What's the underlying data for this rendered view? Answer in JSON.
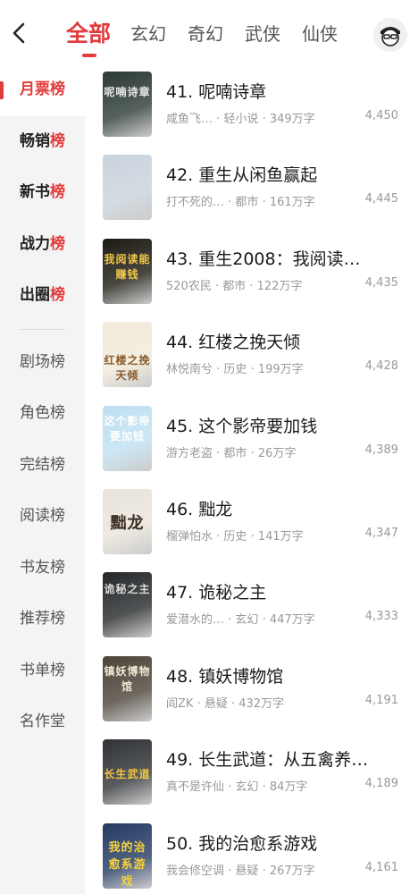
{
  "tabs": [
    "全部",
    "玄幻",
    "奇幻",
    "武侠",
    "仙侠"
  ],
  "sidebar": [
    {
      "main": "月票",
      "tail": "榜"
    },
    {
      "main": "畅销",
      "tail": "榜"
    },
    {
      "main": "新书",
      "tail": "榜"
    },
    {
      "main": "战力",
      "tail": "榜"
    },
    {
      "main": "出圈",
      "tail": "榜"
    },
    {
      "main": "剧场榜",
      "tail": ""
    },
    {
      "main": "角色榜",
      "tail": ""
    },
    {
      "main": "完结榜",
      "tail": ""
    },
    {
      "main": "阅读榜",
      "tail": ""
    },
    {
      "main": "书友榜",
      "tail": ""
    },
    {
      "main": "推荐榜",
      "tail": ""
    },
    {
      "main": "书单榜",
      "tail": ""
    },
    {
      "main": "名作堂",
      "tail": ""
    }
  ],
  "books": [
    {
      "title": "41. 呢喃诗章",
      "author": "咸鱼飞…",
      "genre": "轻小说",
      "words": "349万字",
      "votes": "4,450",
      "cover_text": "呢喃诗章",
      "cover_color": "#2c3a33",
      "cover_text_color": "#e8e8e8"
    },
    {
      "title": "42. 重生从闲鱼赢起",
      "author": "打不死的…",
      "genre": "都市",
      "words": "161万字",
      "votes": "4,445",
      "cover_text": "",
      "cover_color": "#c9d3dc",
      "cover_text_color": "#333333"
    },
    {
      "title": "43. 重生2008：我阅读…",
      "author": "520农民",
      "genre": "都市",
      "words": "122万字",
      "votes": "4,435",
      "cover_text": "我阅读能赚钱",
      "cover_color": "#1d1a12",
      "cover_text_color": "#f0c84a"
    },
    {
      "title": "44. 红楼之挽天倾",
      "author": "林悦南兮",
      "genre": "历史",
      "words": "199万字",
      "votes": "4,428",
      "cover_text": "红楼之挽天倾",
      "cover_color": "#f2ead9",
      "cover_text_color": "#8a5a2b"
    },
    {
      "title": "45. 这个影帝要加钱",
      "author": "游方老盗",
      "genre": "都市",
      "words": "26万字",
      "votes": "4,389",
      "cover_text": "这个影帝要加钱",
      "cover_color": "#bfe0f1",
      "cover_text_color": "#ffffff"
    },
    {
      "title": "46. 黜龙",
      "author": "榴弹怕水",
      "genre": "历史",
      "words": "141万字",
      "votes": "4,347",
      "cover_text": "黜龙",
      "cover_color": "#e9e4da",
      "cover_text_color": "#3a2d24"
    },
    {
      "title": "47. 诡秘之主",
      "author": "爱潜水的…",
      "genre": "玄幻",
      "words": "447万字",
      "votes": "4,333",
      "cover_text": "诡秘之主",
      "cover_color": "#25282a",
      "cover_text_color": "#d8d8d8"
    },
    {
      "title": "48. 镇妖博物馆",
      "author": "阎ZK",
      "genre": "悬疑",
      "words": "432万字",
      "votes": "4,191",
      "cover_text": "镇妖博物馆",
      "cover_color": "#4a4338",
      "cover_text_color": "#f0e6d2"
    },
    {
      "title": "49. 长生武道：从五禽养…",
      "author": "真不是许仙",
      "genre": "玄幻",
      "words": "84万字",
      "votes": "4,189",
      "cover_text": "长生武道",
      "cover_color": "#2f3236",
      "cover_text_color": "#f2c640"
    },
    {
      "title": "50. 我的治愈系游戏",
      "author": "我会修空调",
      "genre": "悬疑",
      "words": "267万字",
      "votes": "4,161",
      "cover_text": "我的治愈系游戏",
      "cover_color": "#243b63",
      "cover_text_color": "#f7d23c"
    }
  ]
}
